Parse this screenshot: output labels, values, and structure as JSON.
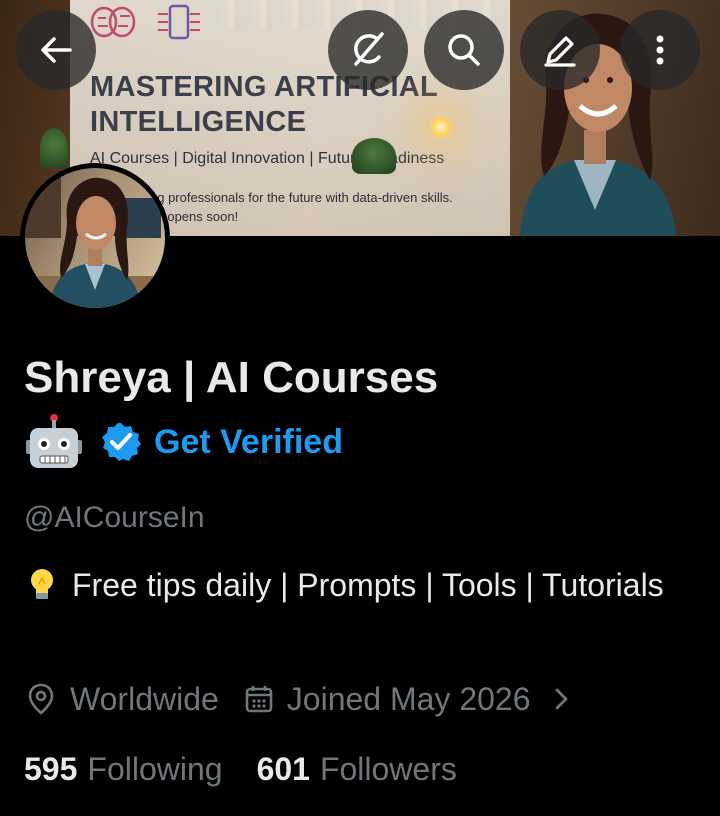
{
  "banner": {
    "title": "MASTERING ARTIFICIAL INTELLIGENCE",
    "subtitle": "AI Courses | Digital Innovation | Future Readiness",
    "tagline_1": "ng professionals for the future with data-driven skills.",
    "tagline_2": "ke opens soon!"
  },
  "toolbar": {
    "back_icon": "arrow-left-icon",
    "grok_icon": "grok-icon",
    "search_icon": "search-icon",
    "edit_icon": "pen-icon",
    "more_icon": "more-vertical-icon"
  },
  "profile": {
    "name": "Shreya | AI Courses",
    "badge_emoji": "robot",
    "verified_label": "Get Verified",
    "handle": "@AICourseIn",
    "bio_emoji": "lightbulb",
    "bio": "Free tips daily | Prompts | Tools | Tutorials",
    "location": "Worldwide",
    "joined": "Joined May 2026",
    "following_count": "595",
    "following_label": "Following",
    "followers_count": "601",
    "followers_label": "Followers"
  },
  "colors": {
    "background": "#000000",
    "accent": "#1d9bf0",
    "text_primary": "#e7e9ea",
    "text_secondary": "#71767b"
  }
}
